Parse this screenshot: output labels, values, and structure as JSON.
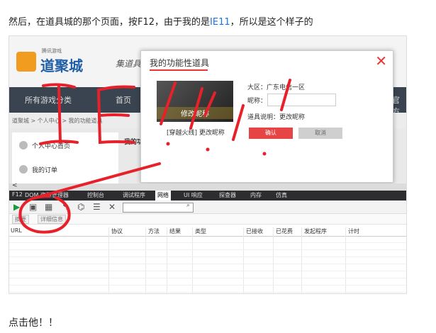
{
  "article": {
    "intro_before": "然后，在道具城的那个页面，按F12，由于我的是",
    "intro_link": "IE11",
    "intro_after": "，所以是这个样子的",
    "outro": "点击他！！"
  },
  "site": {
    "logo_text": "道聚城",
    "logo_tag": "腾讯游戏",
    "slogan": "集道具，聚欢乐",
    "nav": [
      "所有游戏分类",
      "首页"
    ],
    "nav_right": "官方",
    "breadcrumb": "道聚城 > 个人中心 > 我的功能道具",
    "side_items": [
      "个人中心首页",
      "我的订单"
    ],
    "tab_label": "我的功"
  },
  "modal": {
    "title": "我的功能性道具",
    "close": "✕",
    "image_label": "修改昵称",
    "caption": "[穿越火线] 更改昵称",
    "region_label": "大区：广东电信一区",
    "nick_label": "昵称：",
    "desc_label": "道具说明：更改昵称",
    "confirm": "确认",
    "cancel": "取消"
  },
  "devtools": {
    "tabs": [
      "F12",
      "DOM 资源管理器",
      "控制台",
      "调试程序",
      "网络",
      "UI 响应",
      "探查器",
      "内存",
      "仿真"
    ],
    "active_tab": "网络",
    "subtabs": [
      "摘要",
      "详细信息"
    ],
    "columns": [
      "URL",
      "协议",
      "方法",
      "结果",
      "类型",
      "已接收",
      "已花费",
      "发起程序",
      "计时"
    ]
  },
  "annotation": {
    "handwriting": "IE",
    "colors": {
      "ink": "#e8202a"
    }
  }
}
